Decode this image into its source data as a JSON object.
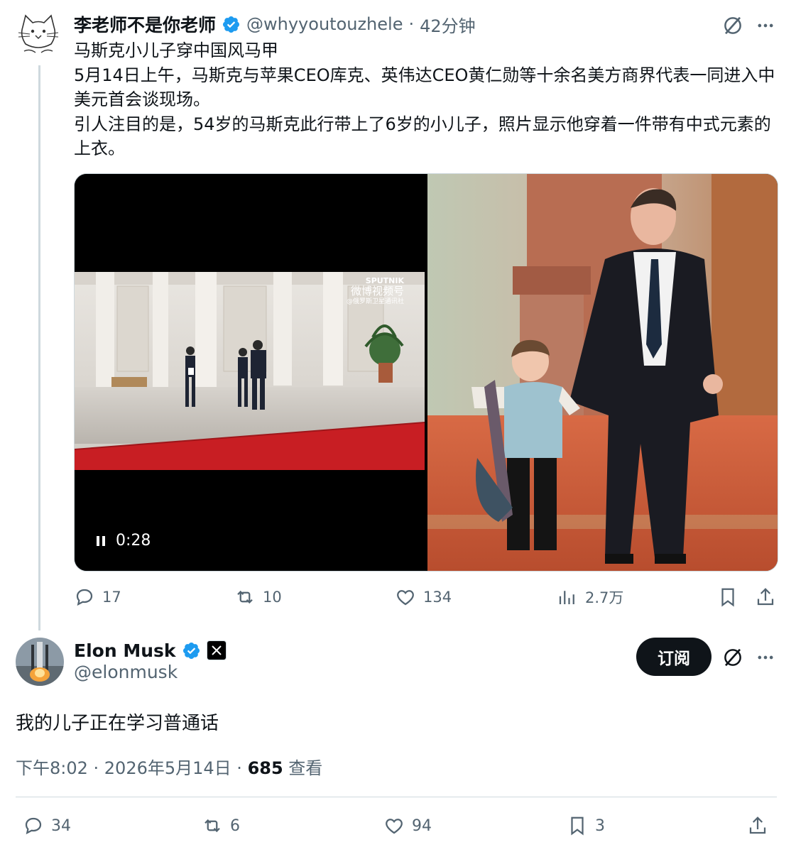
{
  "tweet": {
    "author_name": "李老师不是你老师",
    "handle": "@whyyoutouzhele",
    "sep": "·",
    "time": "42分钟",
    "text": "马斯克小儿子穿中国风马甲\n5月14日上午，马斯克与苹果CEO库克、英伟达CEO黄仁勋等十余名美方商界代表一同进入中美元首会谈现场。\n引人注目的是，54岁的马斯克此行带上了6岁的小儿子，照片显示他穿着一件带有中式元素的上衣。",
    "media": {
      "video_duration": "0:28",
      "watermark_brand": "SPUTNIK",
      "watermark_line1": "微博视频号",
      "watermark_line2": "@俄罗斯卫星通讯社"
    },
    "actions": {
      "replies": "17",
      "retweets": "10",
      "likes": "134",
      "views": "2.7万"
    }
  },
  "reply": {
    "author_name": "Elon Musk",
    "handle": "@elonmusk",
    "subscribe_label": "订阅",
    "text": "我的儿子正在学习普通话",
    "meta_time": "下午8:02 · 2026年5月14日 · ",
    "meta_views_count": "685",
    "meta_views_label": " 查看",
    "actions": {
      "replies": "34",
      "retweets": "6",
      "likes": "94",
      "bookmarks": "3"
    }
  },
  "colors": {
    "verified": "#1d9bf0",
    "muted": "#536471",
    "divider": "#cfd9de",
    "red_carpet": "#c81e23"
  }
}
